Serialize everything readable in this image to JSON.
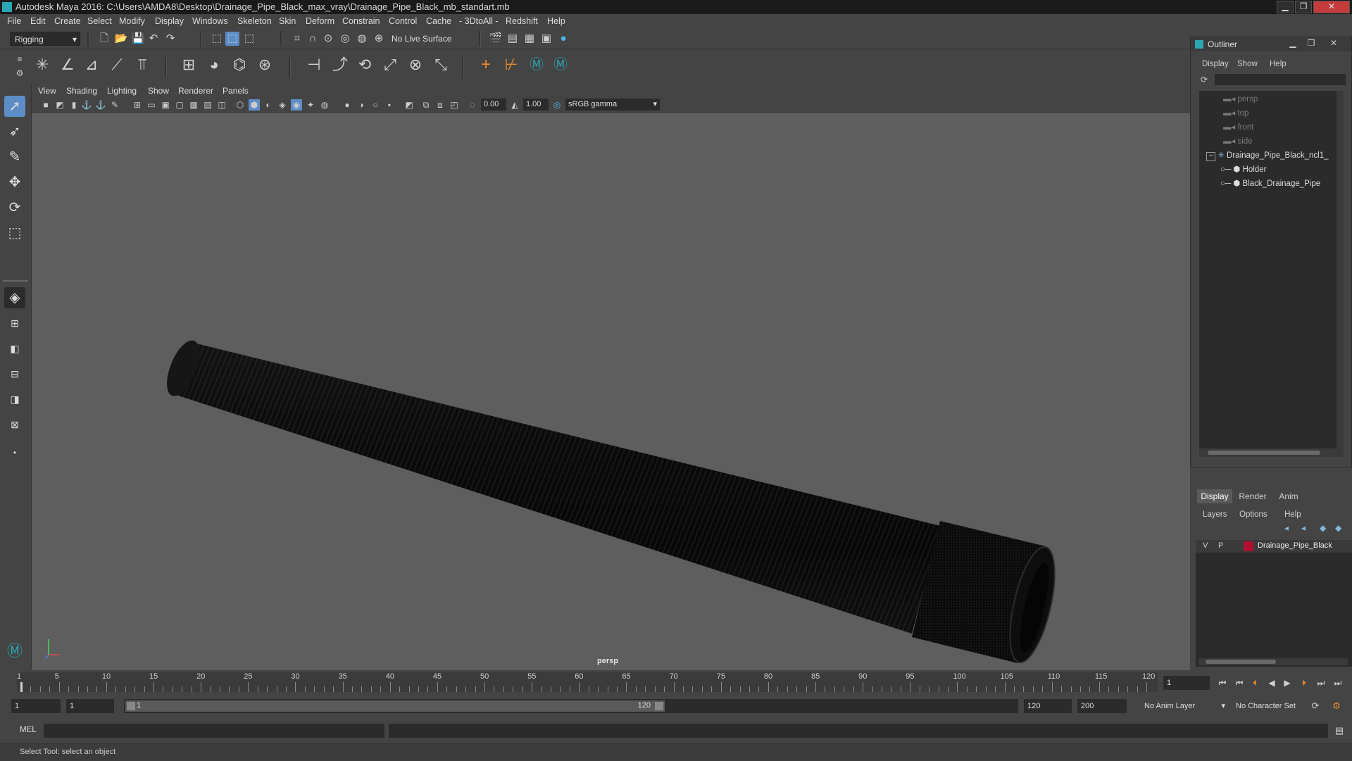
{
  "window": {
    "title": "Autodesk Maya 2016: C:\\Users\\AMDA8\\Desktop\\Drainage_Pipe_Black_max_vray\\Drainage_Pipe_Black_mb_standart.mb",
    "minimize": "▁",
    "maximize": "❐",
    "close": "✕"
  },
  "menubar": [
    "File",
    "Edit",
    "Create",
    "Select",
    "Modify",
    "Display",
    "Windows",
    "Skeleton",
    "Skin",
    "Deform",
    "Constrain",
    "Control",
    "Cache",
    "- 3DtoAll -",
    "Redshift",
    "Help"
  ],
  "statusline": {
    "menuset": "Rigging",
    "live_surface": "No Live Surface"
  },
  "viewport": {
    "menu": [
      "View",
      "Shading",
      "Lighting",
      "Show",
      "Renderer",
      "Panels"
    ],
    "exposure": "0.00",
    "gamma": "1.00",
    "colorspace": "sRGB gamma",
    "camera_label": "persp"
  },
  "outliner": {
    "title": "Outliner",
    "menu": [
      "Display",
      "Show",
      "Help"
    ],
    "cameras": [
      "persp",
      "top",
      "front",
      "side"
    ],
    "group": "Drainage_Pipe_Black_ncl1_",
    "children": [
      "Holder",
      "Black_Drainage_Pipe"
    ],
    "collapse_glyph": "−"
  },
  "layers": {
    "tabs": [
      "Display",
      "Render",
      "Anim"
    ],
    "menu": [
      "Layers",
      "Options",
      "Help"
    ],
    "row": {
      "v": "V",
      "p": "P",
      "name": "Drainage_Pipe_Black",
      "color": "#b01030"
    }
  },
  "timeslider": {
    "labels": [
      "1",
      "5",
      "10",
      "15",
      "20",
      "25",
      "30",
      "35",
      "40",
      "45",
      "50",
      "55",
      "60",
      "65",
      "70",
      "75",
      "80",
      "85",
      "90",
      "95",
      "100",
      "105",
      "110",
      "115",
      "120"
    ],
    "current_frame": "1"
  },
  "rangeslider": {
    "start": "1",
    "anim_start": "1",
    "range_start": "1",
    "range_end": "120",
    "anim_end": "120",
    "end": "200",
    "anim_layer": "No Anim Layer",
    "char_set": "No Character Set"
  },
  "cmdline": {
    "label": "MEL"
  },
  "helpline": {
    "text": "Select Tool: select an object"
  },
  "colors": {
    "accent": "#5d8dc7",
    "mayaTeal": "#2aa7b5",
    "orange": "#e8892c"
  }
}
